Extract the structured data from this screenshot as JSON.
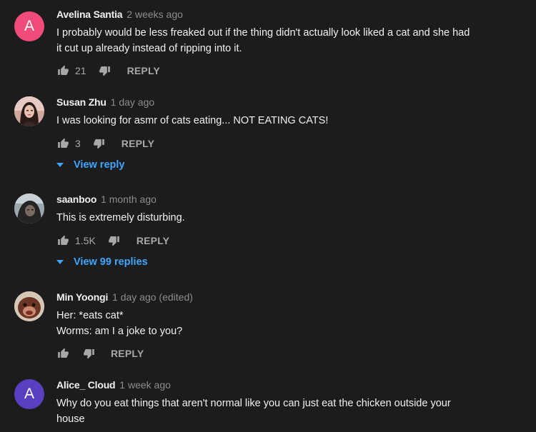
{
  "colors": {
    "background": "#1c1c1c",
    "text": "#f1f1f1",
    "muted": "#8c8c8c",
    "action": "#a8a8a8",
    "link": "#3ea6ff"
  },
  "comments": [
    {
      "author": "Avelina Santia",
      "time": "2 weeks ago",
      "avatar": {
        "type": "letter",
        "letter": "A",
        "color": "#ef4c7a"
      },
      "lines": [
        "I probably would be less freaked out if the thing didn't actually look liked a cat and she had",
        "it cut up already instead of ripping into it."
      ],
      "likes": "21",
      "reply_label": "REPLY"
    },
    {
      "author": "Susan Zhu",
      "time": "1 day ago",
      "avatar": {
        "type": "photo",
        "icon": "user-photo-icon"
      },
      "lines": [
        "I was looking for asmr of cats eating... NOT EATING CATS!"
      ],
      "likes": "3",
      "reply_label": "REPLY",
      "view_replies": "View reply"
    },
    {
      "author": "saanboo",
      "time": "1 month ago",
      "avatar": {
        "type": "photo",
        "icon": "user-photo-icon"
      },
      "lines": [
        "This is extremely disturbing."
      ],
      "likes": "1.5K",
      "reply_label": "REPLY",
      "view_replies": "View 99 replies"
    },
    {
      "author": "Min Yoongi",
      "time": "1 day ago (edited)",
      "avatar": {
        "type": "photo",
        "icon": "user-photo-icon"
      },
      "lines": [
        "Her: *eats cat*",
        "Worms: am I a joke to you?"
      ],
      "likes": "",
      "reply_label": "REPLY"
    },
    {
      "author": "Alice_ Cloud",
      "time": "1 week ago",
      "avatar": {
        "type": "letter",
        "letter": "A",
        "color": "#5a3fc0"
      },
      "lines": [
        "Why do you eat things that aren't normal like you can just eat the chicken outside your",
        "house"
      ]
    }
  ]
}
